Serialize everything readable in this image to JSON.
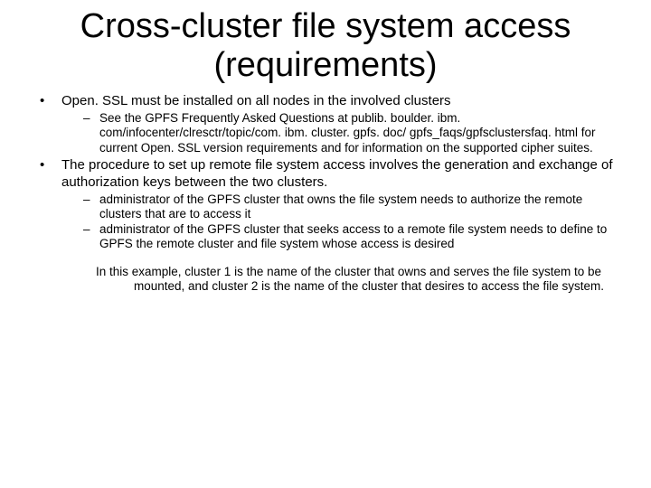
{
  "title": "Cross-cluster file system access (requirements)",
  "bullets": [
    {
      "text": "Open. SSL must be installed on all nodes in the involved clusters",
      "sub": [
        "See the GPFS Frequently Asked Questions at publib. boulder. ibm. com/infocenter/clresctr/topic/com. ibm. cluster. gpfs. doc/ gpfs_faqs/gpfsclustersfaq. html for current Open. SSL version requirements and for information on the supported cipher suites."
      ]
    },
    {
      "text": "The procedure to set up remote file system access involves the generation and exchange of authorization keys between the two clusters.",
      "sub": [
        "administrator of the GPFS cluster that owns the file system needs to authorize the remote clusters that are to access it",
        "administrator of the GPFS cluster that seeks access to a remote file system needs to define to GPFS the remote cluster and file system whose access is desired"
      ]
    }
  ],
  "footer": "In this example, cluster 1 is the name of the cluster that owns and serves the file system to be mounted, and cluster 2 is the name of the cluster that desires to access the file system."
}
